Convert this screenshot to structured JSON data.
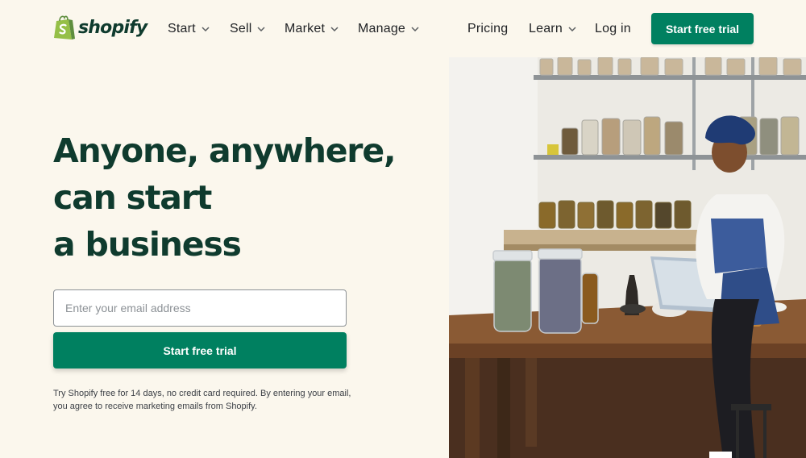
{
  "brand": {
    "name": "shopify",
    "primary_color": "#008060",
    "dark_green": "#0f3b2e",
    "background": "#fbf7ed"
  },
  "nav": {
    "items": [
      {
        "label": "Start",
        "dropdown": true
      },
      {
        "label": "Sell",
        "dropdown": true
      },
      {
        "label": "Market",
        "dropdown": true
      },
      {
        "label": "Manage",
        "dropdown": true
      }
    ],
    "right_items": [
      {
        "label": "Pricing",
        "dropdown": false
      },
      {
        "label": "Learn",
        "dropdown": true
      },
      {
        "label": "Log in",
        "dropdown": false
      }
    ],
    "cta_label": "Start free trial"
  },
  "hero": {
    "headline_lines": [
      "Anyone, anywhere,",
      "can start",
      "a business"
    ],
    "email_placeholder": "Enter your email address",
    "email_value": "",
    "cta_label": "Start free trial",
    "disclaimer_lines": [
      "Try Shopify free for 14 days, no credit card required. By entering your email,",
      "you agree to receive marketing emails from Shopify."
    ]
  },
  "icons": {
    "logo": "shopify-bag-icon",
    "dropdown": "chevron-down-icon"
  }
}
